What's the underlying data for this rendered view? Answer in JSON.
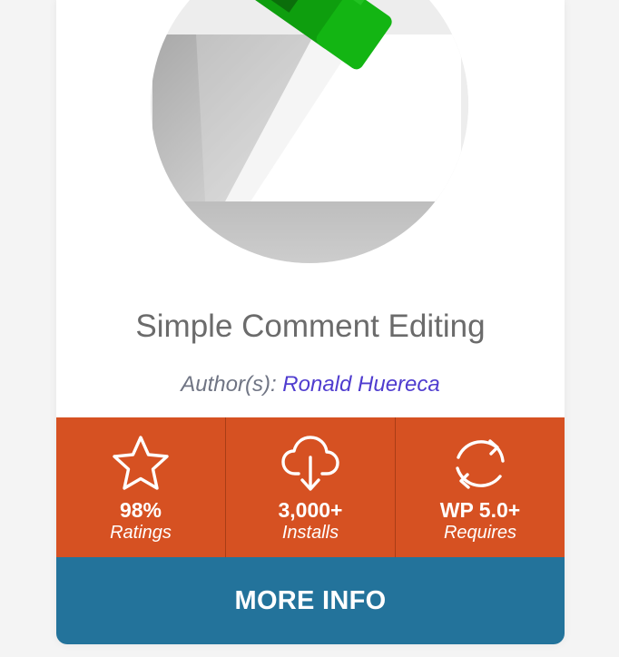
{
  "plugin": {
    "title": "Simple Comment Editing",
    "author_prefix": "Author(s): ",
    "author_name": "Ronald Huereca"
  },
  "stats": [
    {
      "icon": "star-icon",
      "value": "98%",
      "label": "Ratings"
    },
    {
      "icon": "cloud-download-icon",
      "value": "3,000+",
      "label": "Installs"
    },
    {
      "icon": "refresh-icon",
      "value": "WP 5.0+",
      "label": "Requires"
    }
  ],
  "actions": {
    "more_info_label": "MORE INFO"
  },
  "colors": {
    "stats_bg": "#d65122",
    "button_bg": "#23739b",
    "author_link": "#4f3ccf",
    "title_text": "#6b6b6b",
    "logo_accent": "#12b312"
  }
}
